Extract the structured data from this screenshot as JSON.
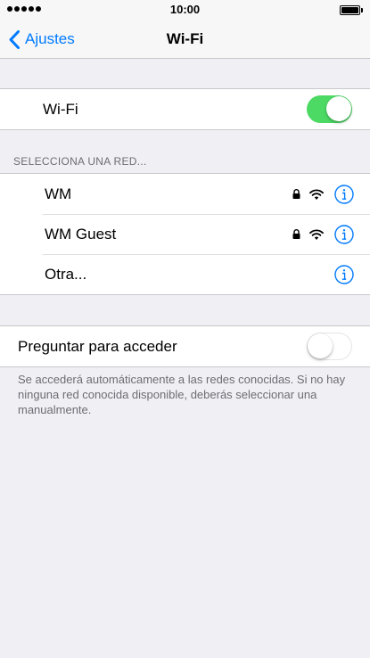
{
  "status_bar": {
    "time": "10:00"
  },
  "nav": {
    "back_label": "Ajustes",
    "title": "Wi-Fi"
  },
  "wifi_row": {
    "label": "Wi-Fi",
    "enabled": true
  },
  "networks_header": "SELECCIONA UNA RED...",
  "networks": [
    {
      "name": "WM",
      "locked": true,
      "signal": "wifi-icon"
    },
    {
      "name": "WM Guest",
      "locked": true,
      "signal": "wifi-icon"
    },
    {
      "name": "Otra...",
      "locked": false
    }
  ],
  "ask_row": {
    "label": "Preguntar para acceder",
    "enabled": false
  },
  "footer_note": "Se accederá automáticamente a las redes conocidas. Si no hay ninguna red conocida disponible, deberás seleccionar una manualmente.",
  "colors": {
    "accent": "#007aff",
    "toggle_on": "#4cd964",
    "background": "#efeff4"
  }
}
